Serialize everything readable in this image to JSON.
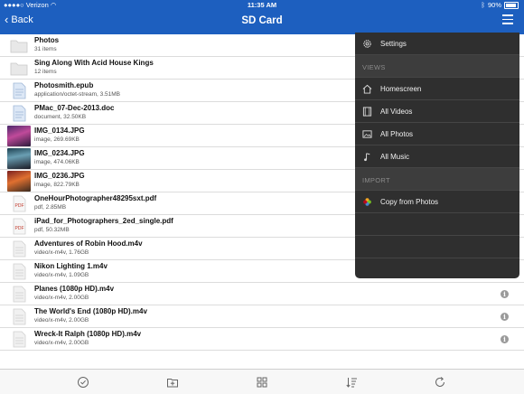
{
  "status": {
    "carrier": "Verizon",
    "time": "11:35 AM",
    "battery": "90%",
    "battery_level": 0.9
  },
  "nav": {
    "back_label": "Back",
    "title": "SD Card"
  },
  "files": [
    {
      "name": "Photos",
      "meta": "31 items"
    },
    {
      "name": "Sing Along With Acid House Kings",
      "meta": "12 items"
    },
    {
      "name": "Photosmith.epub",
      "meta": "application/octet-stream, 3.51MB"
    },
    {
      "name": "PMac_07-Dec-2013.doc",
      "meta": "document, 32.50KB"
    },
    {
      "name": "IMG_0134.JPG",
      "meta": "image, 269.69KB"
    },
    {
      "name": "IMG_0234.JPG",
      "meta": "image, 474.06KB"
    },
    {
      "name": "IMG_0236.JPG",
      "meta": "image, 822.79KB"
    },
    {
      "name": "OneHourPhotographer48295sxt.pdf",
      "meta": "pdf, 2.85MB"
    },
    {
      "name": "iPad_for_Photographers_2ed_single.pdf",
      "meta": "pdf, 50.32MB"
    },
    {
      "name": "Adventures of Robin Hood.m4v",
      "meta": "video/x-m4v, 1.76GB"
    },
    {
      "name": "Nikon Lighting 1.m4v",
      "meta": "video/x-m4v, 1.09GB"
    },
    {
      "name": "Planes (1080p HD).m4v",
      "meta": "video/x-m4v, 2.00GB"
    },
    {
      "name": "The World's End (1080p HD).m4v",
      "meta": "video/x-m4v, 2.00GB"
    },
    {
      "name": "Wreck-It Ralph (1080p HD).m4v",
      "meta": "video/x-m4v, 2.00GB"
    }
  ],
  "info_glyph": "i",
  "menu": {
    "settings": "Settings",
    "views_header": "VIEWS",
    "homescreen": "Homescreen",
    "all_videos": "All Videos",
    "all_photos": "All Photos",
    "all_music": "All Music",
    "import_header": "IMPORT",
    "copy_from_photos": "Copy from Photos"
  },
  "colors": {
    "header": "#1d5fbf",
    "menu_bg": "#2f2f2f"
  }
}
